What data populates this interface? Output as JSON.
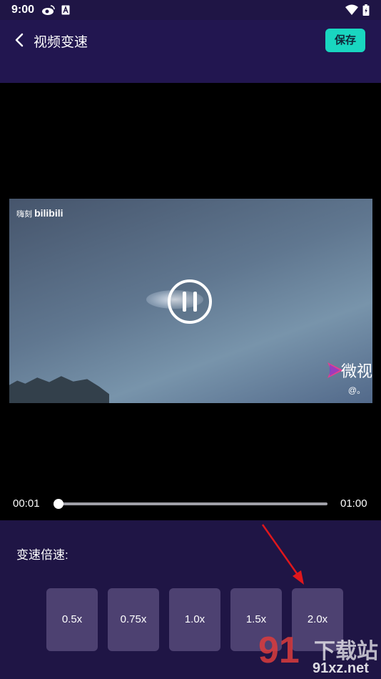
{
  "status_bar": {
    "time": "9:00"
  },
  "header": {
    "title": "视频变速",
    "save_label": "保存"
  },
  "video": {
    "watermark_left_small": "嗨刻",
    "watermark_left_big": "bilibili",
    "watermark_right": "微视",
    "watermark_handle": "@。"
  },
  "player": {
    "current_time": "00:01",
    "total_time": "01:00",
    "progress": 0.0
  },
  "speed": {
    "label": "变速倍速:",
    "options": [
      "0.5x",
      "0.75x",
      "1.0x",
      "1.5x",
      "2.0x"
    ]
  },
  "site_watermark": {
    "logo": "91",
    "cn": "下载站",
    "url": "91xz.net"
  },
  "colors": {
    "background": "#1f1545",
    "header": "#221650",
    "accent": "#19d6c0",
    "button": "#4d4171",
    "arrow": "#e0171c"
  }
}
